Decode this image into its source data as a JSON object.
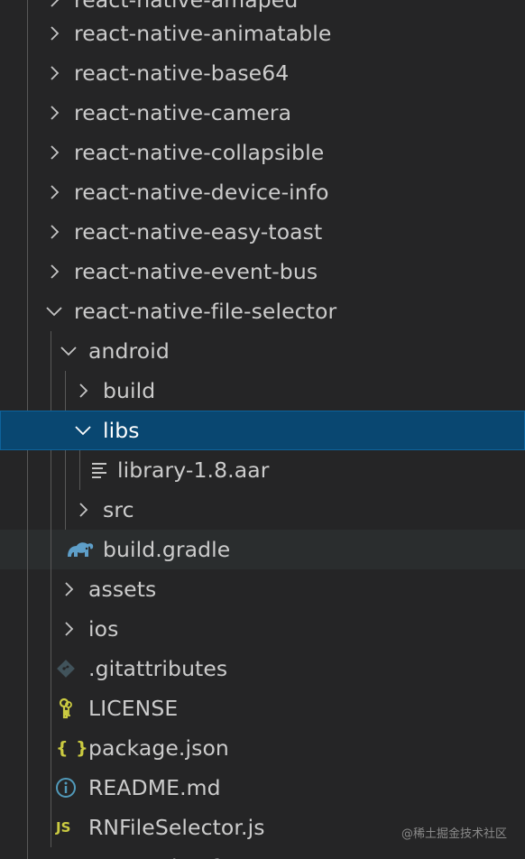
{
  "explorer": {
    "rows": [
      {
        "label": "react-native-amaped",
        "kind": "folder",
        "expanded": false
      },
      {
        "label": "react-native-animatable",
        "kind": "folder",
        "expanded": false
      },
      {
        "label": "react-native-base64",
        "kind": "folder",
        "expanded": false
      },
      {
        "label": "react-native-camera",
        "kind": "folder",
        "expanded": false
      },
      {
        "label": "react-native-collapsible",
        "kind": "folder",
        "expanded": false
      },
      {
        "label": "react-native-device-info",
        "kind": "folder",
        "expanded": false
      },
      {
        "label": "react-native-easy-toast",
        "kind": "folder",
        "expanded": false
      },
      {
        "label": "react-native-event-bus",
        "kind": "folder",
        "expanded": false
      },
      {
        "label": "react-native-file-selector",
        "kind": "folder",
        "expanded": true
      },
      {
        "label": "android",
        "kind": "folder",
        "expanded": true
      },
      {
        "label": "build",
        "kind": "folder",
        "expanded": false
      },
      {
        "label": "libs",
        "kind": "folder",
        "expanded": true,
        "selected": true
      },
      {
        "label": "library-1.8.aar",
        "kind": "file",
        "icon": "text-file-icon"
      },
      {
        "label": "src",
        "kind": "folder",
        "expanded": false
      },
      {
        "label": "build.gradle",
        "kind": "file",
        "icon": "gradle-elephant-icon",
        "hover": true
      },
      {
        "label": "assets",
        "kind": "folder",
        "expanded": false
      },
      {
        "label": "ios",
        "kind": "folder",
        "expanded": false
      },
      {
        "label": ".gitattributes",
        "kind": "file",
        "icon": "git-icon"
      },
      {
        "label": "LICENSE",
        "kind": "file",
        "icon": "license-key-icon"
      },
      {
        "label": "package.json",
        "kind": "file",
        "icon": "json-braces-icon"
      },
      {
        "label": "README.md",
        "kind": "file",
        "icon": "info-icon"
      },
      {
        "label": "RNFileSelector.js",
        "kind": "file",
        "icon": "js-icon"
      },
      {
        "label": "react-native-fs",
        "kind": "folder",
        "expanded": false
      }
    ],
    "js_badge": "JS",
    "json_badge": "{ }"
  },
  "watermark": "@稀土掘金技术社区",
  "colors": {
    "background": "#252526",
    "selection": "#094771",
    "selection_border": "#0e639c",
    "hover": "#2a2d2e",
    "text": "#cccccc",
    "gradle": "#5e9fc9",
    "json": "#cbcb41",
    "info": "#519aba",
    "license": "#cbcb41",
    "git": "#41535b"
  }
}
